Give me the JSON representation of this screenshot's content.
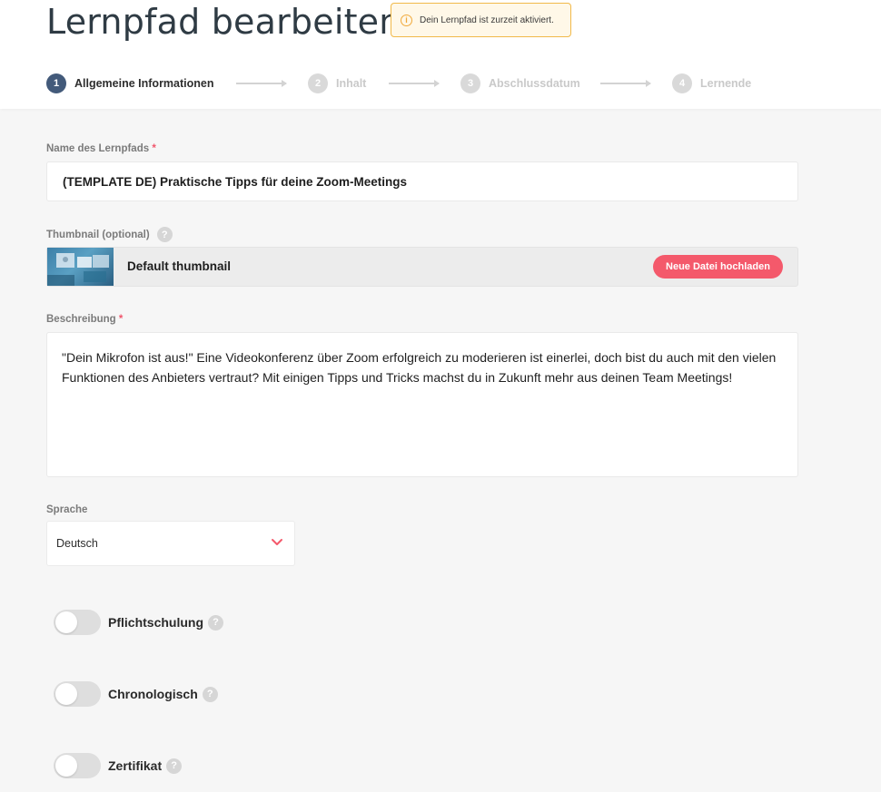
{
  "page": {
    "title": "Lernpfad bearbeiten",
    "notice": "Dein Lernpfad ist zurzeit aktiviert.",
    "notice_icon": "info-icon"
  },
  "stepper": {
    "steps": [
      {
        "number": "1",
        "label": "Allgemeine Informationen",
        "state": "active"
      },
      {
        "number": "2",
        "label": "Inhalt",
        "state": "inactive"
      },
      {
        "number": "3",
        "label": "Abschlussdatum",
        "state": "inactive"
      },
      {
        "number": "4",
        "label": "Lernende",
        "state": "inactive"
      }
    ]
  },
  "form": {
    "name": {
      "label": "Name des Lernpfads",
      "required_mark": "*",
      "value": "(TEMPLATE DE)  Praktische Tipps für deine Zoom-Meetings"
    },
    "thumbnail": {
      "label": "Thumbnail (optional)",
      "help": "?",
      "file_name": "Default thumbnail",
      "upload_button": "Neue Datei hochladen"
    },
    "description": {
      "label": "Beschreibung",
      "required_mark": "*",
      "value": "\"Dein Mikrofon ist aus!\" Eine Videokonferenz über Zoom erfolgreich zu moderieren ist einerlei, doch bist du auch mit den vielen Funktionen des Anbieters vertraut? Mit einigen Tipps und Tricks machst du in Zukunft mehr aus deinen Team Meetings!"
    },
    "language": {
      "label": "Sprache",
      "selected": "Deutsch",
      "icon": "chevron-down-icon"
    },
    "toggles": [
      {
        "label": "Pflichtschulung",
        "help": "?",
        "on": false
      },
      {
        "label": "Chronologisch",
        "help": "?",
        "on": false
      },
      {
        "label": "Zertifikat",
        "help": "?",
        "on": false
      }
    ]
  },
  "colors": {
    "accent": "#f4596b",
    "step_active": "#435a7a",
    "notice_border": "#f1b94a"
  }
}
